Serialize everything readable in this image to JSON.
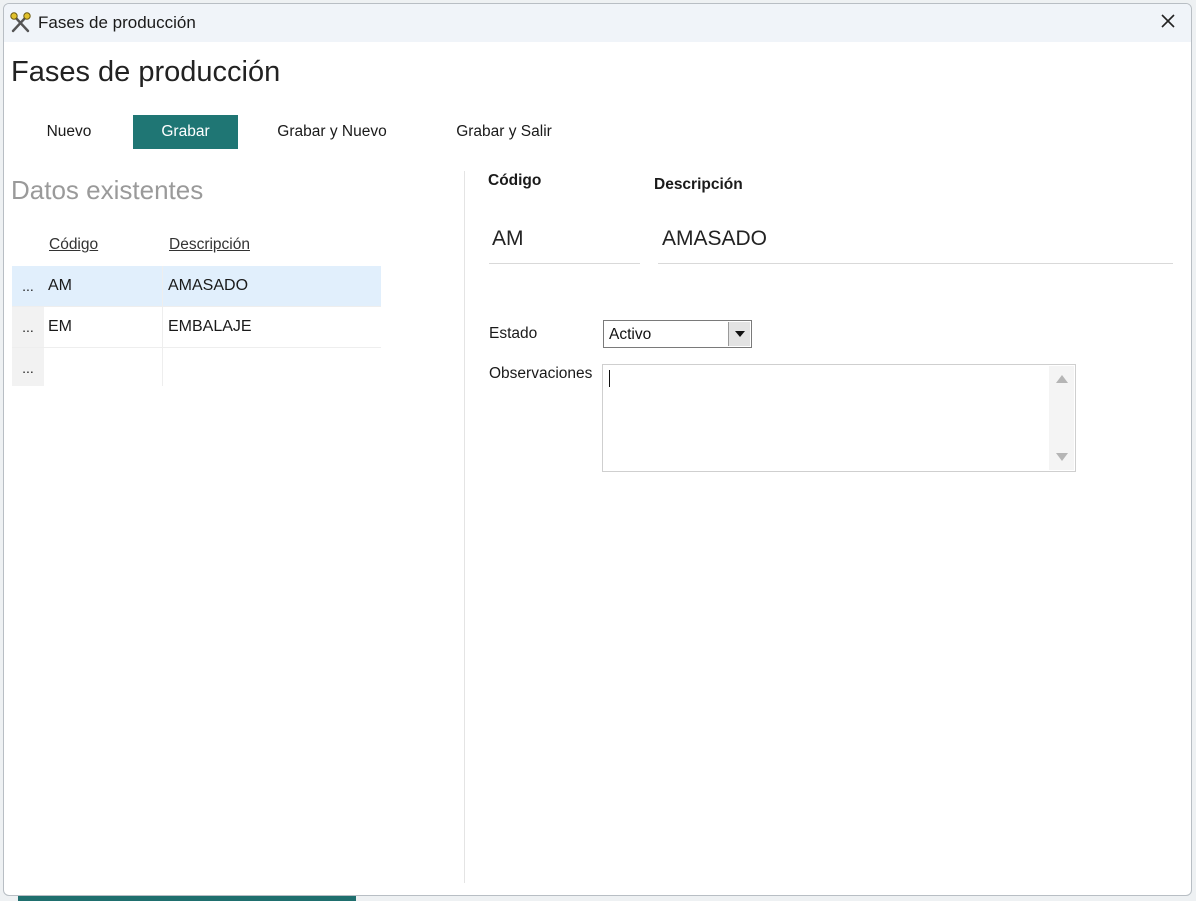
{
  "window": {
    "title": "Fases de producción",
    "title_icon": "tools-icon",
    "close_icon": "close-icon"
  },
  "page": {
    "title": "Fases de producción"
  },
  "toolbar": {
    "new_label": "Nuevo",
    "save_label": "Grabar",
    "save_new_label": "Grabar y Nuevo",
    "save_exit_label": "Grabar y Salir"
  },
  "existing": {
    "heading": "Datos existentes",
    "columns": {
      "code": "Código",
      "description": "Descripción"
    },
    "rows": [
      {
        "selector": "...",
        "code": "AM",
        "description": "AMASADO",
        "selected": true
      },
      {
        "selector": "...",
        "code": "EM",
        "description": "EMBALAJE",
        "selected": false
      },
      {
        "selector": "...",
        "code": "",
        "description": "",
        "selected": false
      }
    ]
  },
  "form": {
    "code_label": "Código",
    "code_value": "AM",
    "description_label": "Descripción",
    "description_value": "AMASADO",
    "status_label": "Estado",
    "status_value": "Activo",
    "notes_label": "Observaciones",
    "notes_value": ""
  },
  "colors": {
    "accent": "#1f7674",
    "selected_row": "#e1effc",
    "heading_gray": "#9a9a9a"
  }
}
